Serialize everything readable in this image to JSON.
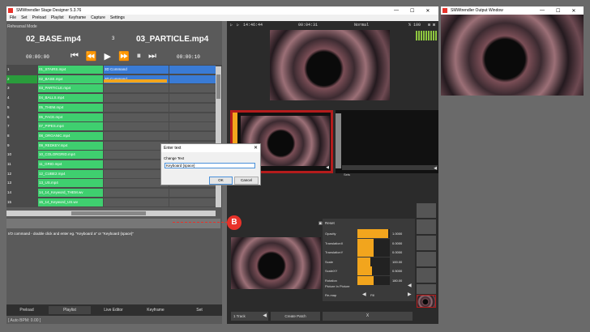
{
  "main_window": {
    "title": "SMWtrendler Stage Designer 5.3.76",
    "menu": [
      "File",
      "Set",
      "Preload",
      "Playlist",
      "Keyframe",
      "Capture",
      "Settings"
    ],
    "mode": "Rehearsal Mode",
    "current_clip": "02_BASE.mp4",
    "clip_index": "3",
    "next_clip": "03_PARTICLE.mp4",
    "time_left": "00:00:00",
    "time_right": "00:00:10"
  },
  "rows": [
    {
      "num": "1",
      "clip": "01_STAIRS.mp4",
      "cmd": "3D Command"
    },
    {
      "num": "2",
      "clip": "02_BASE.mp4",
      "cmd": "3D Command"
    },
    {
      "num": "3",
      "clip": "03_PARTICLE.mp4",
      "cmd": ""
    },
    {
      "num": "4",
      "clip": "04_BALLS.mp4",
      "cmd": ""
    },
    {
      "num": "5",
      "clip": "05_THEM.mp4",
      "cmd": ""
    },
    {
      "num": "6",
      "clip": "06_FACE.mp4",
      "cmd": ""
    },
    {
      "num": "7",
      "clip": "07_PIPES.mp4",
      "cmd": ""
    },
    {
      "num": "8",
      "clip": "08_ORGANIC.mp4",
      "cmd": ""
    },
    {
      "num": "9",
      "clip": "09_REDKEY.mp4",
      "cmd": ""
    },
    {
      "num": "10",
      "clip": "10_COLORGRID.mp4",
      "cmd": ""
    },
    {
      "num": "11",
      "clip": "11_GRID.mp4",
      "cmd": ""
    },
    {
      "num": "12",
      "clip": "12_CUBE2.mp4",
      "cmd": ""
    },
    {
      "num": "13",
      "clip": "13_US.mp4",
      "cmd": ""
    },
    {
      "num": "14",
      "clip": "14_14_Keyword_THEM.wv",
      "cmd": ""
    },
    {
      "num": "15",
      "clip": "15_14_Keyword_US.wv",
      "cmd": ""
    }
  ],
  "hint": "I/O command - double click and enter eg. \"Keyboard a\" or \"Keyboard {space}\"",
  "tabs": [
    "Preload",
    "Playlist",
    "Live Editor",
    "Keyframe",
    "Set"
  ],
  "status": "[ Auto BPM: 0.00 ]",
  "dialog": {
    "title": "Enter text",
    "label": "Change Text",
    "value": "Keyboard {space}",
    "ok": "OK",
    "cancel": "Cancel"
  },
  "marker": "B",
  "preview": {
    "time1": "14:46:44",
    "time2": "00:04:31",
    "blend": "Normal",
    "pct": "% 100",
    "slot_label": "Sets"
  },
  "props": {
    "header": "Reset",
    "items": [
      {
        "name": "Opacity",
        "value": "1.0000",
        "fill": 0.95
      },
      {
        "name": "TranslationX",
        "value": "0.0000",
        "fill": 0.5
      },
      {
        "name": "TranslationY",
        "value": "0.0000",
        "fill": 0.5
      },
      {
        "name": "Scale",
        "value": "100.00",
        "fill": 0.4
      },
      {
        "name": "ScaleXY",
        "value": "0.5000",
        "fill": 0.45
      },
      {
        "name": "Rotation",
        "value": "180.00",
        "fill": 0.5
      }
    ],
    "pip_label": "Picture In Picture",
    "mode_label": "Re-map",
    "mode_value": "Fill"
  },
  "bottom": {
    "track": "1 Track",
    "create": "Create Patch",
    "x": "X"
  },
  "output_window": {
    "title": "SMWtrendler Output Window"
  },
  "colors": {
    "accent": "#f2a51d",
    "green": "#3fcf6f",
    "marker": "#e8322a"
  }
}
